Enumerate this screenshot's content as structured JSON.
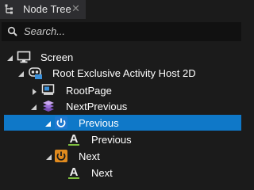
{
  "panel": {
    "tab_title": "Node Tree",
    "close_glyph": "✕",
    "tab_icon": "tree-nodes-icon"
  },
  "search": {
    "placeholder": "Search...",
    "icon": "search-icon"
  },
  "tree": [
    {
      "label": "Screen",
      "icon": "monitor-icon",
      "expander": "expanded",
      "selected": false
    },
    {
      "label": "Root Exclusive Activity Host 2D",
      "icon": "activity-host-icon",
      "expander": "expanded",
      "selected": false
    },
    {
      "label": "RootPage",
      "icon": "page-icon",
      "expander": "collapsed",
      "selected": false
    },
    {
      "label": "NextPrevious",
      "icon": "layers-icon",
      "expander": "expanded",
      "selected": false
    },
    {
      "label": "Previous",
      "icon": "power-button-icon",
      "expander": "expanded",
      "selected": true
    },
    {
      "label": "Previous",
      "icon": "text-block-icon",
      "expander": "none",
      "selected": false
    },
    {
      "label": "Next",
      "icon": "power-button-icon",
      "expander": "expanded",
      "selected": false
    },
    {
      "label": "Next",
      "icon": "text-block-icon",
      "expander": "none",
      "selected": false
    }
  ],
  "colors": {
    "selection": "#0f78c8",
    "background": "#1b1b1b",
    "tab": "#2d2d30",
    "button_blue": "#1e78d0",
    "button_orange": "#e08a1e",
    "text_icon_green": "#7fbf3f"
  }
}
